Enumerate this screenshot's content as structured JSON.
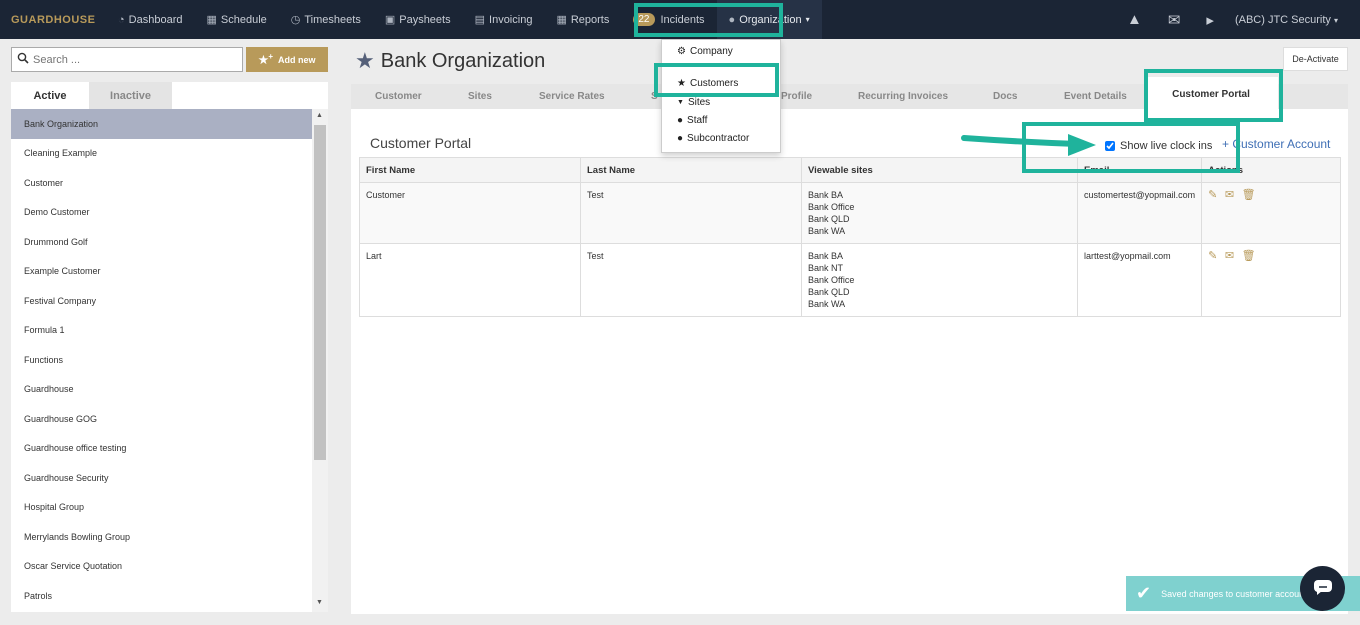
{
  "nav": {
    "brand": "GUARDHOUSE",
    "items": [
      {
        "label": "Dashboard",
        "icon": "dashboard-icon",
        "glyph": "◔"
      },
      {
        "label": "Schedule",
        "icon": "calendar-icon",
        "glyph": "▦"
      },
      {
        "label": "Timesheets",
        "icon": "clock-icon",
        "glyph": "◷"
      },
      {
        "label": "Paysheets",
        "icon": "money-icon",
        "glyph": "▣"
      },
      {
        "label": "Invoicing",
        "icon": "invoice-icon",
        "glyph": "▤"
      },
      {
        "label": "Reports",
        "icon": "table-icon",
        "glyph": "▦"
      }
    ],
    "incidents_count": "22",
    "incidents_label": "Incidents",
    "organization_label": "Organization",
    "account_label": "(ABC) JTC Security"
  },
  "org_menu": {
    "items": [
      {
        "label": "Company",
        "icon": "gear-icon",
        "glyph": "⚙"
      },
      {
        "label": "Customers",
        "icon": "star-icon",
        "glyph": "★"
      },
      {
        "label": "Sites",
        "icon": "map-marker-icon",
        "glyph": "▼"
      },
      {
        "label": "Staff",
        "icon": "user-icon",
        "glyph": "●"
      },
      {
        "label": "Subcontractor",
        "icon": "user-icon",
        "glyph": "●"
      }
    ]
  },
  "sidebar": {
    "search_placeholder": "Search ...",
    "add_new_label": "Add new",
    "tab_active": "Active",
    "tab_inactive": "Inactive",
    "customers": [
      "Bank Organization",
      "Cleaning Example",
      "Customer",
      "Demo Customer",
      "Drummond Golf",
      "Example Customer",
      "Festival Company",
      "Formula 1",
      "Functions",
      "Guardhouse",
      "Guardhouse GOG",
      "Guardhouse office testing",
      "Guardhouse Security",
      "Hospital Group",
      "Merrylands Bowling Group",
      "Oscar Service Quotation",
      "Patrols"
    ]
  },
  "main": {
    "title": "Bank Organization",
    "deactivate_label": "De-Activate",
    "tabs": [
      "Customer",
      "Sites",
      "Service Rates",
      "Profile",
      "Recurring Invoices",
      "Docs",
      "Event Details",
      "Customer Portal"
    ],
    "tab_partial": "S",
    "portal_title": "Customer Portal",
    "show_live_label": "Show live clock ins",
    "add_account_label": "+ Customer Account",
    "table": {
      "headers": [
        "First Name",
        "Last Name",
        "Viewable sites",
        "Email",
        "Actions"
      ],
      "rows": [
        {
          "first": "Customer",
          "last": "Test",
          "sites": [
            "Bank BA",
            "Bank Office",
            "Bank QLD",
            "Bank WA"
          ],
          "email": "customertest@yopmail.com"
        },
        {
          "first": "Lart",
          "last": "Test",
          "sites": [
            "Bank BA",
            "Bank NT",
            "Bank Office",
            "Bank QLD",
            "Bank WA"
          ],
          "email": "larttest@yopmail.com"
        }
      ]
    }
  },
  "toast": {
    "message": "Saved changes to customer account"
  },
  "colors": {
    "navbar": "#1b2535",
    "gold": "#b89a5a",
    "highlight": "#1fb39c",
    "selected": "#aab0c3"
  }
}
